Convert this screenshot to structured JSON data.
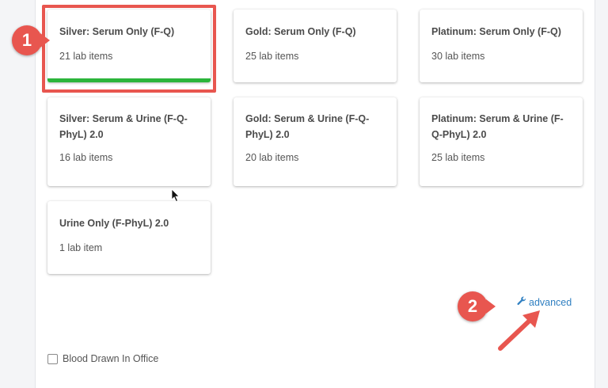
{
  "cards": [
    {
      "title": "Silver: Serum Only (F-Q)",
      "count": "21 lab items",
      "selected": true
    },
    {
      "title": "Gold: Serum Only (F-Q)",
      "count": "25 lab items"
    },
    {
      "title": "Platinum: Serum Only (F-Q)",
      "count": "30 lab items"
    },
    {
      "title": "Silver: Serum & Urine (F-Q-PhyL) 2.0",
      "count": "16 lab items"
    },
    {
      "title": "Gold: Serum & Urine (F-Q-PhyL) 2.0",
      "count": "20 lab items"
    },
    {
      "title": "Platinum: Serum & Urine (F-Q-PhyL) 2.0",
      "count": "25 lab items"
    },
    {
      "title": "Urine Only (F-PhyL) 2.0",
      "count": "1 lab item"
    }
  ],
  "advanced_link": {
    "label": "advanced",
    "icon": "wrench-icon"
  },
  "blood_drawn": {
    "label": "Blood Drawn In Office",
    "checked": false
  },
  "annotations": {
    "step1": "1",
    "step2": "2"
  },
  "colors": {
    "selected_bar": "#2bb53b",
    "annotation": "#e8564f",
    "link": "#2f7fc1"
  }
}
